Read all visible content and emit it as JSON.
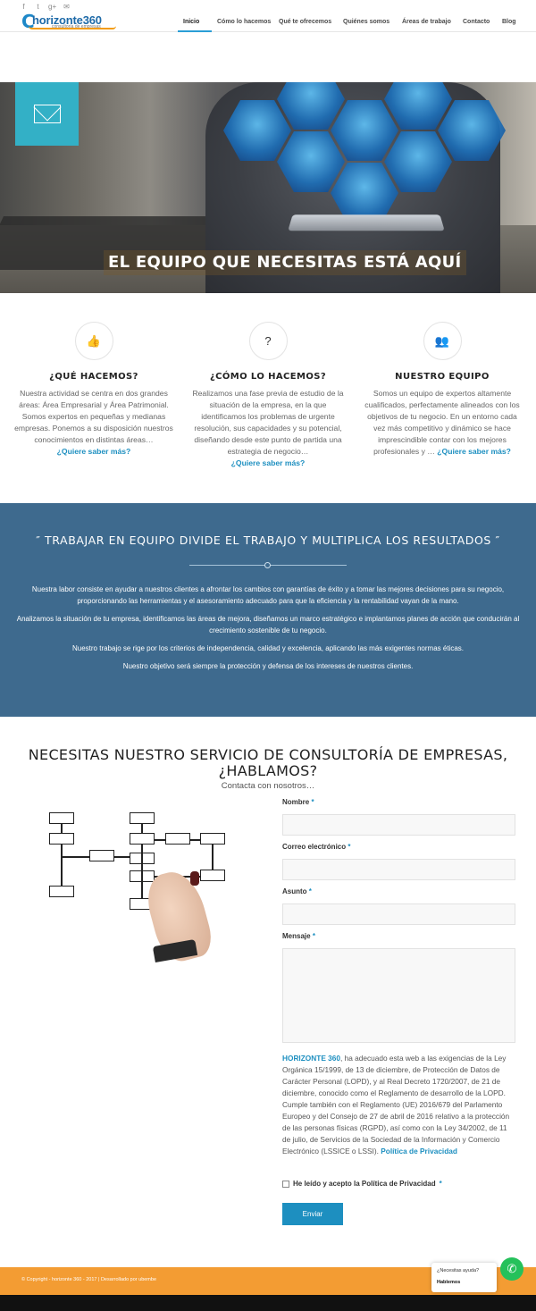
{
  "header": {
    "social": [
      "f",
      "t",
      "g+",
      "✉"
    ],
    "logo_text": "horizonte360",
    "logo_tagline": "consultoría de empresas",
    "nav": [
      "Inicio",
      "Cómo lo hacemos",
      "Qué te ofrecemos",
      "Quiénes somos",
      "Áreas de trabajo",
      "Contacto",
      "Blog"
    ],
    "active_nav": "Inicio"
  },
  "hero": {
    "title": "EL EQUIPO QUE NECESITAS ESTÁ AQUÍ",
    "icon": "envelope-icon"
  },
  "features": [
    {
      "icon": "thumbs-up-icon",
      "glyph": "👍",
      "title": "¿QUÉ HACEMOS?",
      "text": "Nuestra actividad se centra en dos grandes áreas: Área Empresarial y Área Patrimonial. Somos expertos en pequeñas y medianas empresas. Ponemos a su disposición nuestros conocimientos en distintas áreas…",
      "link": "¿Quiere saber más?"
    },
    {
      "icon": "question-icon",
      "glyph": "?",
      "title": "¿CÓMO LO HACEMOS?",
      "text": "Realizamos una fase previa de estudio de la situación de la empresa, en la que identificamos los problemas de urgente resolución, sus capacidades y su potencial, diseñando desde este punto de partida una estrategia de negocio…",
      "link": "¿Quiere saber más?"
    },
    {
      "icon": "users-icon",
      "glyph": "👥",
      "title": "NUESTRO EQUIPO",
      "text": "Somos un equipo de expertos altamente cualificados, perfectamente alineados con los objetivos de tu negocio. En un entorno cada vez más competitivo y dinámico se hace imprescindible contar con los mejores profesionales y …",
      "link": "¿Quiere saber más?"
    }
  ],
  "quote": {
    "title": "″ TRABAJAR EN EQUIPO DIVIDE EL TRABAJO Y MULTIPLICA LOS RESULTADOS ″",
    "paragraphs": [
      "Nuestra labor consiste en ayudar a nuestros clientes a afrontar los cambios con garantías de éxito y a tomar las mejores decisiones para su negocio, proporcionando las herramientas y el asesoramiento adecuado para que la eficiencia y la rentabilidad vayan de la mano.",
      "Analizamos la situación de tu empresa, identificamos las áreas de mejora, diseñamos un marco estratégico e implantamos planes de acción que conducirán al crecimiento sostenible de tu negocio.",
      "Nuestro trabajo se rige por los criterios de independencia, calidad y excelencia, aplicando las más exigentes normas éticas.",
      "Nuestro objetivo será siempre la protección y defensa de los intereses de nuestros clientes."
    ]
  },
  "contact": {
    "title": "NECESITAS NUESTRO SERVICIO DE CONSULTORÍA DE EMPRESAS, ¿HABLAMOS?",
    "subtitle": "Contacta con nosotros…",
    "fields": {
      "name_label": "Nombre",
      "email_label": "Correo electrónico",
      "subject_label": "Asunto",
      "message_label": "Mensaje",
      "required_mark": "*"
    },
    "legal_brand": "HORIZONTE 360",
    "legal_text": ", ha adecuado esta web a las exigencias de la Ley Orgánica 15/1999, de 13 de diciembre, de Protección de Datos de Carácter Personal (LOPD), y al Real Decreto 1720/2007, de 21 de diciembre, conocido como el Reglamento de desarrollo de la LOPD. Cumple también con el Reglamento (UE) 2016/679 del Parlamento Europeo y del Consejo de 27 de abril de 2016 relativo a la protección de las personas físicas (RGPD), así como con la Ley 34/2002, de 11 de julio, de Servicios de la Sociedad de la Información y Comercio Electrónico (LSSICE o LSSI).",
    "privacy_link": "Política de Privacidad",
    "consent_label": "He leído y acepto la Política de Privacidad",
    "submit_label": "Enviar"
  },
  "footer": {
    "copyright": "© Copyright - horizonte 360 - 2017 | Desarrollado por ubembe"
  },
  "whatsapp": {
    "line1": "¿Necesitas ayuda?",
    "line2": "Hablemos"
  },
  "colors": {
    "accent": "#1d8fc0",
    "quote_bg": "#3e6a8e",
    "footer_bg": "#f39c33",
    "mail_tile": "#33b0c6",
    "whatsapp": "#25c15b"
  }
}
